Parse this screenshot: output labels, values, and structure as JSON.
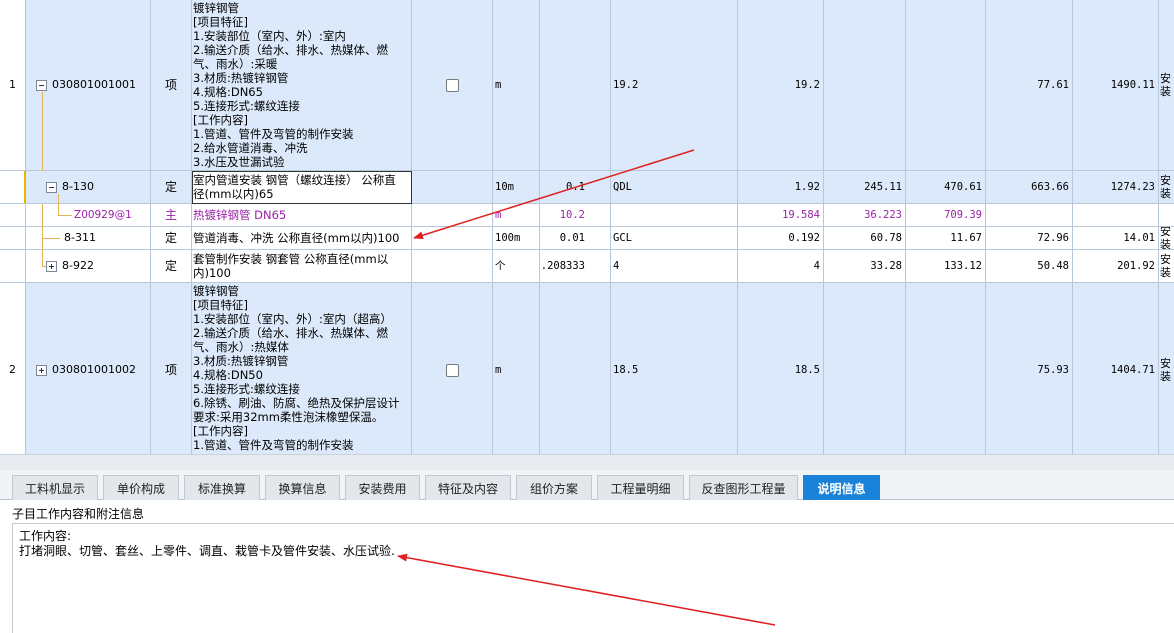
{
  "rows": [
    {
      "num": "1",
      "code": "030801001001",
      "type": "项",
      "name_lines": [
        "镀锌钢管",
        "[项目特征]",
        "1.安装部位（室内、外）:室内",
        "2.输送介质（给水、排水、热媒体、燃",
        "气、雨水）:采暖",
        "3.材质:热镀锌钢管",
        "4.规格:DN65",
        "5.连接形式:螺纹连接",
        "[工作内容]",
        "1.管道、管件及弯管的制作安装",
        "2.给水管道消毒、冲洗",
        "3.水压及世漏试验"
      ],
      "unit": "m",
      "qtyx": "",
      "expr": "19.2",
      "qty": "19.2",
      "p1": "",
      "p2": "",
      "p3": "77.61",
      "p4": "1490.11",
      "last": "安装"
    },
    {
      "num": "",
      "code": "8-130",
      "type": "定",
      "name_lines": [
        "室内管道安装 钢管（螺纹连接） 公称直",
        "径(mm以内)65"
      ],
      "unit": "10m",
      "qtyx": "0.1",
      "expr": "QDL",
      "qty": "1.92",
      "p1": "245.11",
      "p2": "470.61",
      "p3": "663.66",
      "p4": "1274.23",
      "last": "安装"
    },
    {
      "num": "",
      "code": "Z00929@1",
      "type": "主",
      "name_lines": [
        "热镀锌钢管 DN65"
      ],
      "unit": "m",
      "qtyx": "10.2",
      "expr": "",
      "qty": "19.584",
      "p1": "36.223",
      "p2": "709.39",
      "p3": "",
      "p4": "",
      "last": ""
    },
    {
      "num": "",
      "code": "8-311",
      "type": "定",
      "name_lines": [
        "管道消毒、冲洗 公称直径(mm以内)100"
      ],
      "unit": "100m",
      "qtyx": "0.01",
      "expr": "GCL",
      "qty": "0.192",
      "p1": "60.78",
      "p2": "11.67",
      "p3": "72.96",
      "p4": "14.01",
      "last": "安装"
    },
    {
      "num": "",
      "code": "8-922",
      "type": "定",
      "name_lines": [
        "套管制作安装 钢套管 公称直径(mm以",
        "内)100"
      ],
      "unit": "个",
      "qtyx": "0.208333",
      "expr": "4",
      "qty": "4",
      "p1": "33.28",
      "p2": "133.12",
      "p3": "50.48",
      "p4": "201.92",
      "last": "安装"
    },
    {
      "num": "2",
      "code": "030801001002",
      "type": "项",
      "name_lines": [
        "镀锌钢管",
        "[项目特征]",
        "1.安装部位（室内、外）:室内（超高）",
        "2.输送介质（给水、排水、热媒体、燃",
        "气、雨水）:热媒体",
        "3.材质:热镀锌钢管",
        "4.规格:DN50",
        "5.连接形式:螺纹连接",
        "6.除锈、刷油、防腐、绝热及保护层设计",
        "要求:采用32mm柔性泡沫橡塑保温。",
        "[工作内容]",
        "1.管道、管件及弯管的制作安装"
      ],
      "unit": "m",
      "qtyx": "",
      "expr": "18.5",
      "qty": "18.5",
      "p1": "",
      "p2": "",
      "p3": "75.93",
      "p4": "1404.71",
      "last": "安装"
    }
  ],
  "tabs": [
    "工料机显示",
    "单价构成",
    "标准换算",
    "换算信息",
    "安装费用",
    "特征及内容",
    "组价方案",
    "工程量明细",
    "反查图形工程量",
    "说明信息"
  ],
  "active_tab": "说明信息",
  "panel": {
    "title": "子目工作内容和附注信息",
    "line1": "工作内容:",
    "line2": "打堵洞眼、切管、套丝、上零件、调直、栽管卡及管件安装、水压试验."
  },
  "colors": {
    "accent": "#1b82d9",
    "row_blue": "#dbe9fa",
    "main_material": "#9b1fa8",
    "arrow": "#e02020"
  }
}
